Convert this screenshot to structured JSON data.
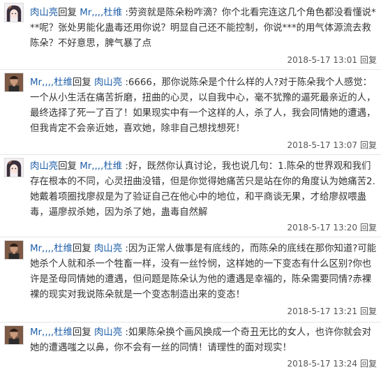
{
  "reply_word": "回复",
  "reply_action": "回复",
  "comments": [
    {
      "author": "肉山亮",
      "target": "Mr,,,,杜维",
      "text": ":劳资就是陈朵粉咋滴？你个北看完连这几个角色都没看懂说***呢？张处男能化蛊毒还用你说？明显自己还不能控制，你说***的用气体源流去救陈朵？不好意思，脾气暴了点",
      "time": "2018-5-17 13:01"
    },
    {
      "author": "Mr,,,,杜维",
      "target": "肉山亮",
      "text": ":6666，那你说陈朵是个什么样的人?对于陈朵我个人感觉：一个从小生活在痛苦折磨，扭曲的心灵，以自我中心，毫不犹豫的逼死最亲近的人，最终选择了死一了百了！如果现实中有一个这样的人，杀了人，我会同情她的遭遇，但我肯定不会亲近她，喜欢她，除非自己想找想死！",
      "time": "2018-5-17 13:07"
    },
    {
      "author": "肉山亮",
      "target": "Mr,,,,杜维",
      "text": ":好，既然你认真讨论，我也说几句：1.陈朵的世界观和我们存在根本的不同，心灵扭曲没错，但是你觉得她痛苦只是站在你的角度认为她痛苦2.她戴着项圈找廖叔是为了验证自己在他心中的地位，和平商谈无果，才给廖叔喂蛊毒，逼廖叔杀她，因为杀了她，蛊毒自然解",
      "time": "2018-5-17 13:20"
    },
    {
      "author": "Mr,,,,杜维",
      "target": "肉山亮",
      "text": ":因为正常人做事是有底线的，而陈朵的底线在那你知道?可能她杀个人就和杀一个牲畜一样，没有一丝怜悯，这样她的一下变态有什么区别?你也许是圣母同情她的遭遇，但问题是陈朵认为他的遭遇是幸福的，陈朵需要同情?赤裸裸的现实对我说陈朵就是一个变态制造出来的变态！",
      "time": "2018-5-17 13:21"
    },
    {
      "author": "Mr,,,,杜维",
      "target": "肉山亮",
      "text": ":如果陈朵换个画风换成一个奇丑无比的女人，也许你就会对她的遭遇嗤之以鼻，你不会有一丝的同情！请理性的面对现实！",
      "time": "2018-5-17 13:24"
    }
  ]
}
